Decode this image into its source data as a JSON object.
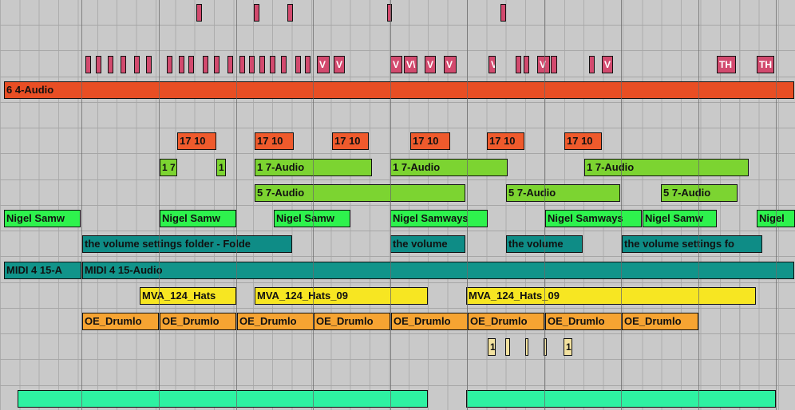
{
  "lanes": [
    {
      "color": "#d24a6e",
      "clips": [
        [
          246,
          7,
          ""
        ],
        [
          318,
          7,
          ""
        ],
        [
          360,
          7,
          ""
        ],
        [
          485,
          6,
          ""
        ],
        [
          627,
          7,
          ""
        ]
      ]
    },
    {
      "color": "#d24a6e",
      "clips": []
    },
    {
      "color": "#d24a6e",
      "clips": [
        [
          107,
          7,
          ""
        ],
        [
          120,
          7,
          ""
        ],
        [
          135,
          7,
          ""
        ],
        [
          151,
          7,
          ""
        ],
        [
          168,
          7,
          ""
        ],
        [
          183,
          7,
          ""
        ],
        [
          209,
          7,
          ""
        ],
        [
          224,
          7,
          ""
        ],
        [
          236,
          7,
          ""
        ],
        [
          254,
          7,
          ""
        ],
        [
          268,
          7,
          ""
        ],
        [
          285,
          7,
          ""
        ],
        [
          300,
          7,
          ""
        ],
        [
          312,
          7,
          ""
        ],
        [
          325,
          7,
          ""
        ],
        [
          338,
          7,
          ""
        ],
        [
          352,
          7,
          ""
        ],
        [
          370,
          7,
          ""
        ],
        [
          382,
          7,
          ""
        ],
        [
          397,
          16,
          "V"
        ],
        [
          418,
          14,
          "V"
        ],
        [
          489,
          15,
          "V"
        ],
        [
          506,
          17,
          "V\\"
        ],
        [
          532,
          14,
          "V"
        ],
        [
          556,
          16,
          "V"
        ],
        [
          612,
          9,
          "V"
        ],
        [
          646,
          7,
          ""
        ],
        [
          656,
          7,
          ""
        ],
        [
          673,
          16,
          "V"
        ],
        [
          690,
          8,
          ""
        ],
        [
          738,
          7,
          ""
        ],
        [
          754,
          14,
          "V"
        ],
        [
          898,
          24,
          "TH"
        ],
        [
          948,
          22,
          "TH"
        ]
      ]
    },
    {
      "color": "#e84e24",
      "clips": [
        [
          5,
          990,
          "6 4-Audio"
        ]
      ]
    },
    {
      "color": "#ef5a2c",
      "clips": []
    },
    {
      "color": "#ef5a2c",
      "clips": [
        [
          222,
          49,
          "17 10"
        ],
        [
          319,
          49,
          "17 10"
        ],
        [
          416,
          46,
          "17 10"
        ],
        [
          514,
          50,
          "17 10"
        ],
        [
          610,
          47,
          "17 10"
        ],
        [
          707,
          47,
          "17 10"
        ]
      ]
    },
    {
      "color": "#7cd431",
      "clips": [
        [
          200,
          22,
          "1 7"
        ],
        [
          271,
          12,
          "1"
        ],
        [
          319,
          147,
          "1 7-Audio"
        ],
        [
          489,
          147,
          "1 7-Audio"
        ],
        [
          732,
          206,
          "1 7-Audio"
        ]
      ]
    },
    {
      "color": "#7cd431",
      "clips": [
        [
          319,
          264,
          "5 7-Audio"
        ],
        [
          634,
          143,
          "5 7-Audio"
        ],
        [
          828,
          96,
          "5 7-Audio"
        ]
      ]
    },
    {
      "color": "#2ef24d",
      "clips": [
        [
          5,
          96,
          "Nigel Samw"
        ],
        [
          200,
          96,
          "Nigel Samw"
        ],
        [
          343,
          96,
          "Nigel Samw"
        ],
        [
          489,
          122,
          "Nigel Samways"
        ],
        [
          683,
          121,
          "Nigel Samways"
        ],
        [
          805,
          93,
          "Nigel Samw"
        ],
        [
          948,
          48,
          "Nigel"
        ]
      ]
    },
    {
      "color": "#0e8c86",
      "clips": [
        [
          103,
          263,
          "the volume settings folder - Folde"
        ],
        [
          489,
          94,
          "the volume"
        ],
        [
          634,
          96,
          "the volume"
        ],
        [
          779,
          176,
          "the volume settings fo"
        ]
      ]
    },
    {
      "color": "#11948a",
      "clips": [
        [
          5,
          97,
          "MIDI 4 15-A"
        ],
        [
          103,
          892,
          "MIDI 4 15-Audio"
        ]
      ]
    },
    {
      "color": "#f7e622",
      "clips": [
        [
          175,
          121,
          "MVA_124_Hats"
        ],
        [
          319,
          217,
          "MVA_124_Hats_09"
        ],
        [
          584,
          363,
          "MVA_124_Hats_09"
        ]
      ]
    },
    {
      "color": "#f6a432",
      "clips": [
        [
          103,
          96,
          "OE_Drumlo"
        ],
        [
          200,
          96,
          "OE_Drumlo"
        ],
        [
          297,
          96,
          "OE_Drumlo"
        ],
        [
          393,
          96,
          "OE_Drumlo"
        ],
        [
          490,
          96,
          "OE_Drumlo"
        ],
        [
          586,
          96,
          "OE_Drumlo"
        ],
        [
          683,
          96,
          "OE_Drumlo"
        ],
        [
          779,
          96,
          "OE_Drumlo"
        ]
      ]
    },
    {
      "color": "#f3e2a0",
      "clips": [
        [
          611,
          10,
          "1"
        ],
        [
          633,
          6,
          ""
        ],
        [
          658,
          4,
          ""
        ],
        [
          681,
          4,
          ""
        ],
        [
          706,
          11,
          "1"
        ]
      ]
    },
    {
      "color": "#d0d0d0",
      "clips": []
    },
    {
      "color": "#2ef2a2",
      "clips": [
        [
          22,
          514,
          ""
        ],
        [
          584,
          388,
          ""
        ]
      ]
    }
  ],
  "barlines": [
    102,
    199,
    296,
    392,
    489,
    585,
    682,
    778,
    875,
    972
  ]
}
